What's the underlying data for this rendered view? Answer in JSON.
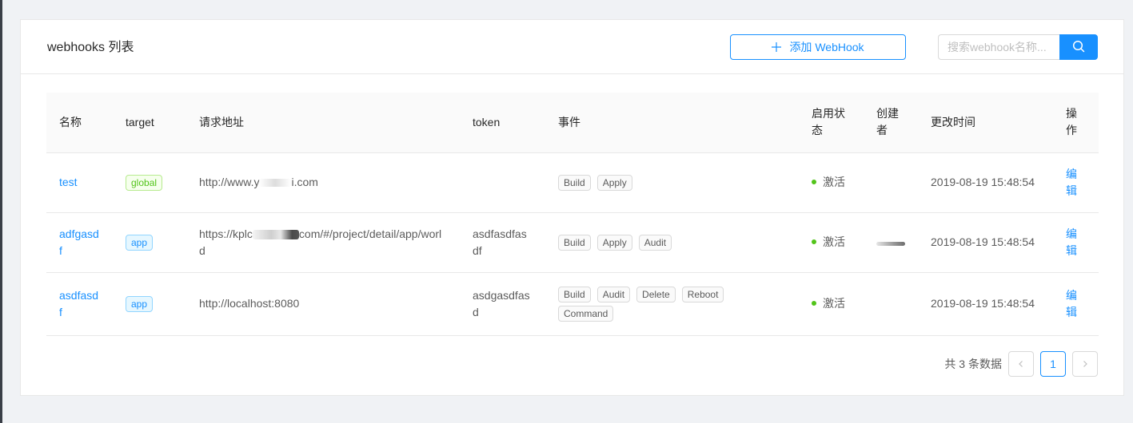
{
  "card": {
    "title": "webhooks 列表",
    "add_button_label": "添加 WebHook",
    "search_placeholder": "搜索webhook名称..."
  },
  "table": {
    "columns": [
      "名称",
      "target",
      "请求地址",
      "token",
      "事件",
      "启用状态",
      "创建者",
      "更改时间",
      "操作"
    ],
    "rows": [
      {
        "name": "test",
        "target": "global",
        "url_parts": [
          "http://www.y",
          "i.com"
        ],
        "token": "",
        "events": [
          "Build",
          "Apply"
        ],
        "status": "激活",
        "updated": "2019-08-19 15:48:54",
        "action": "编辑"
      },
      {
        "name": "adfgasdf",
        "target": "app",
        "url_parts": [
          "https://kplc",
          "com/#/project/detail/app/world"
        ],
        "token": "asdfasdfasdf",
        "events": [
          "Build",
          "Apply",
          "Audit"
        ],
        "status": "激活",
        "updated": "2019-08-19 15:48:54",
        "action": "编辑"
      },
      {
        "name": "asdfasdf",
        "target": "app",
        "url_parts": [
          "http://localhost:8080"
        ],
        "token": "asdgasdfasd",
        "events": [
          "Build",
          "Audit",
          "Delete",
          "Reboot",
          "Command"
        ],
        "status": "激活",
        "updated": "2019-08-19 15:48:54",
        "action": "编辑"
      }
    ]
  },
  "pagination": {
    "total_text": "共 3 条数据",
    "current_page": "1",
    "prev_icon": "chevron-left-icon",
    "next_icon": "chevron-right-icon"
  },
  "colors": {
    "primary": "#1890ff",
    "success": "#52c41a"
  }
}
